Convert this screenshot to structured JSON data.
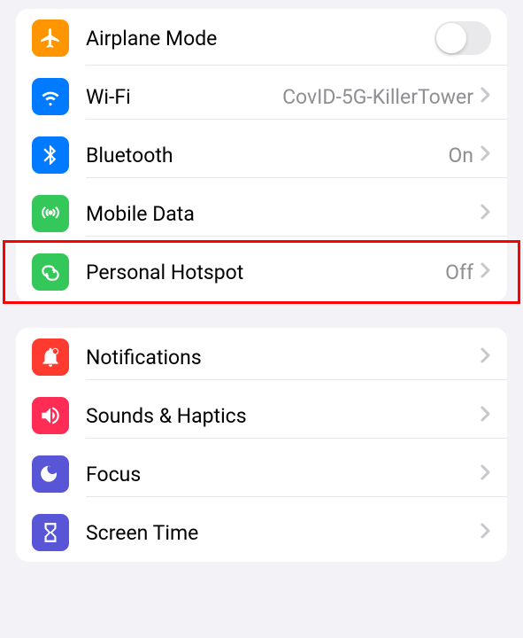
{
  "group1": {
    "airplane": {
      "label": "Airplane Mode",
      "toggle": false
    },
    "wifi": {
      "label": "Wi-Fi",
      "value": "CovID-5G-KillerTower"
    },
    "bluetooth": {
      "label": "Bluetooth",
      "value": "On"
    },
    "mobiledata": {
      "label": "Mobile Data"
    },
    "hotspot": {
      "label": "Personal Hotspot",
      "value": "Off",
      "highlighted": true
    }
  },
  "group2": {
    "notifications": {
      "label": "Notifications"
    },
    "sounds": {
      "label": "Sounds & Haptics"
    },
    "focus": {
      "label": "Focus"
    },
    "screentime": {
      "label": "Screen Time"
    }
  }
}
